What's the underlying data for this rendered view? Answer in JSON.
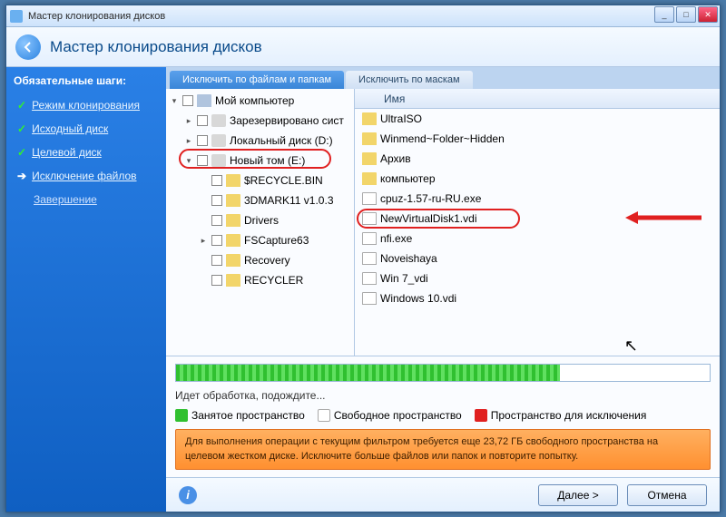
{
  "window_title": "Мастер клонирования дисков",
  "header_title": "Мастер клонирования дисков",
  "sidebar": {
    "heading": "Обязательные шаги:",
    "steps": [
      {
        "label": "Режим клонирования",
        "state": "done"
      },
      {
        "label": "Исходный диск",
        "state": "done"
      },
      {
        "label": "Целевой диск",
        "state": "done"
      },
      {
        "label": "Исключение файлов",
        "state": "current"
      },
      {
        "label": "Завершение",
        "state": "future"
      }
    ]
  },
  "tabs": {
    "active": "Исключить по файлам и папкам",
    "inactive": "Исключить по маскам"
  },
  "tree": [
    {
      "indent": 0,
      "expander": "▾",
      "icon": "pc",
      "label": "Мой компьютер"
    },
    {
      "indent": 1,
      "expander": "▸",
      "icon": "disk",
      "label": "Зарезервировано сист"
    },
    {
      "indent": 1,
      "expander": "▸",
      "icon": "disk",
      "label": "Локальный диск (D:)"
    },
    {
      "indent": 1,
      "expander": "▾",
      "icon": "disk",
      "label": "Новый том (E:)",
      "highlight": true
    },
    {
      "indent": 2,
      "expander": "",
      "icon": "folder",
      "label": "$RECYCLE.BIN"
    },
    {
      "indent": 2,
      "expander": "",
      "icon": "folder",
      "label": "3DMARK11 v1.0.3"
    },
    {
      "indent": 2,
      "expander": "",
      "icon": "folder",
      "label": "Drivers"
    },
    {
      "indent": 2,
      "expander": "▸",
      "icon": "folder",
      "label": "FSCapture63"
    },
    {
      "indent": 2,
      "expander": "",
      "icon": "folder",
      "label": "Recovery"
    },
    {
      "indent": 2,
      "expander": "",
      "icon": "folder",
      "label": "RECYCLER"
    }
  ],
  "list_header": "Имя",
  "list": [
    {
      "icon": "folder",
      "label": "UltraISO",
      "checked": false
    },
    {
      "icon": "folder",
      "label": "Winmend~Folder~Hidden",
      "checked": false
    },
    {
      "icon": "folder",
      "label": "Архив",
      "checked": false
    },
    {
      "icon": "folder",
      "label": "компьютер",
      "checked": false
    },
    {
      "icon": "file",
      "label": "cpuz-1.57-ru-RU.exe",
      "checked": false
    },
    {
      "icon": "file",
      "label": "NewVirtualDisk1.vdi",
      "checked": true,
      "highlight": true
    },
    {
      "icon": "file",
      "label": "nfi.exe",
      "checked": false
    },
    {
      "icon": "file",
      "label": "Noveishaya",
      "checked": false
    },
    {
      "icon": "file",
      "label": "Win 7_vdi",
      "checked": false
    },
    {
      "icon": "file",
      "label": "Windows 10.vdi",
      "checked": false
    }
  ],
  "status_text": "Идет обработка, подождите...",
  "legend": {
    "used": "Занятое пространство",
    "free": "Свободное пространство",
    "excl": "Пространство для исключения"
  },
  "warning_text": "Для выполнения операции с текущим фильтром требуется еще 23,72 ГБ свободного пространства на целевом жестком диске. Исключите больше файлов или папок и повторите попытку.",
  "buttons": {
    "next": "Далее >",
    "cancel": "Отмена"
  },
  "progress_percent": 72
}
